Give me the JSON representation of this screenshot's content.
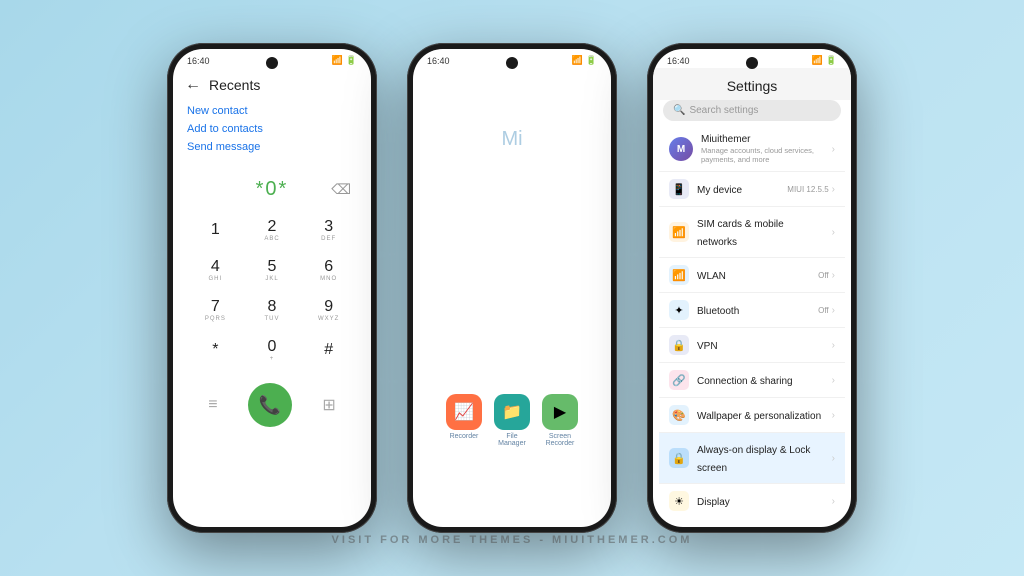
{
  "watermark": {
    "text": "VISIT FOR MORE THEMES - MIUITHEMER.COM"
  },
  "phone1": {
    "statusBar": {
      "time": "16:40",
      "icons": "🔋"
    },
    "header": {
      "title": "Recents"
    },
    "options": [
      {
        "label": "New contact"
      },
      {
        "label": "Add to contacts"
      },
      {
        "label": "Send message"
      }
    ],
    "display": "*0*",
    "dialpad": [
      [
        {
          "num": "1",
          "sub": ""
        },
        {
          "num": "2",
          "sub": "ABC"
        },
        {
          "num": "3",
          "sub": "DEF"
        }
      ],
      [
        {
          "num": "4",
          "sub": "GHI"
        },
        {
          "num": "5",
          "sub": "JKL"
        },
        {
          "num": "6",
          "sub": "MNO"
        }
      ],
      [
        {
          "num": "7",
          "sub": "PQRS"
        },
        {
          "num": "8",
          "sub": "TUV"
        },
        {
          "num": "9",
          "sub": "WXYZ"
        }
      ],
      [
        {
          "num": "*",
          "sub": "."
        },
        {
          "num": "0",
          "sub": "+"
        },
        {
          "num": "#",
          "sub": ""
        }
      ]
    ]
  },
  "phone2": {
    "statusBar": {
      "time": "16:40"
    },
    "miText": "Mi",
    "apps": [
      {
        "label": "Recorder",
        "color": "#ff7043",
        "icon": "📈"
      },
      {
        "label": "File\nManager",
        "color": "#4CAF50",
        "icon": "📁"
      },
      {
        "label": "Screen\nRecorder",
        "color": "#43a047",
        "icon": "▶"
      }
    ]
  },
  "phone3": {
    "statusBar": {
      "time": "16:40"
    },
    "title": "Settings",
    "searchPlaceholder": "Search settings",
    "items": [
      {
        "id": "miuithemer",
        "name": "Miuithemer",
        "sub": "Manage accounts, cloud services, payments, and more",
        "iconColor": "#667eea",
        "iconChar": "M",
        "type": "avatar"
      },
      {
        "id": "mydevice",
        "name": "My device",
        "badge": "MIUI 12.5.5",
        "iconColor": "#5c6bc0",
        "iconChar": "📱",
        "type": "icon"
      },
      {
        "id": "simcards",
        "name": "SIM cards & mobile networks",
        "iconColor": "#f5a623",
        "iconChar": "📶",
        "type": "icon"
      },
      {
        "id": "wlan",
        "name": "WLAN",
        "status": "Off",
        "iconColor": "#2196F3",
        "iconChar": "📶",
        "type": "icon"
      },
      {
        "id": "bluetooth",
        "name": "Bluetooth",
        "status": "Off",
        "iconColor": "#2196F3",
        "iconChar": "✦",
        "type": "icon"
      },
      {
        "id": "vpn",
        "name": "VPN",
        "iconColor": "#3f51b5",
        "iconChar": "🔒",
        "type": "icon"
      },
      {
        "id": "connection",
        "name": "Connection & sharing",
        "iconColor": "#e91e63",
        "iconChar": "🔗",
        "type": "icon"
      },
      {
        "id": "wallpaper",
        "name": "Wallpaper & personalization",
        "iconColor": "#2196F3",
        "iconChar": "🎨",
        "type": "icon"
      },
      {
        "id": "alwayson",
        "name": "Always-on display & Lock screen",
        "iconColor": "#2196F3",
        "iconChar": "🔒",
        "type": "icon",
        "highlighted": true
      },
      {
        "id": "display",
        "name": "Display",
        "iconColor": "#ffc107",
        "iconChar": "☀",
        "type": "icon"
      }
    ]
  }
}
